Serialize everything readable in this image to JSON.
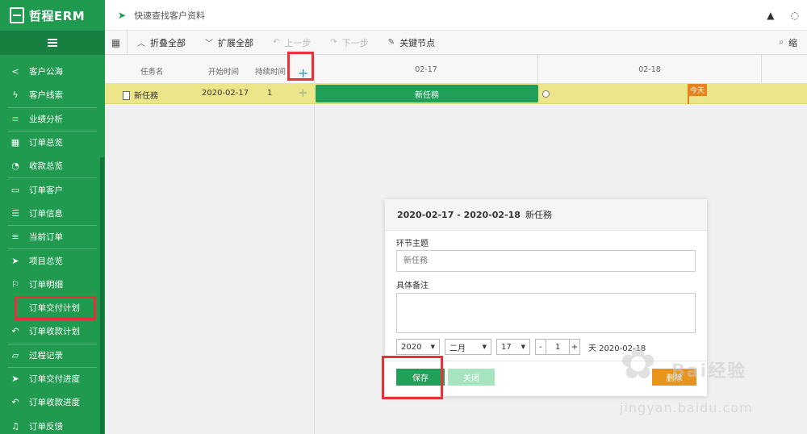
{
  "app": {
    "brand": "哲程ERM"
  },
  "sidebar": {
    "items": [
      {
        "label": "客户公海",
        "icon": "share-icon"
      },
      {
        "label": "客户线索",
        "icon": "bolt-icon"
      },
      {
        "label": "业绩分析",
        "icon": "bars-icon"
      },
      {
        "label": "订单总览",
        "icon": "grid-icon"
      },
      {
        "label": "收款总览",
        "icon": "rss-icon"
      },
      {
        "label": "订单客户",
        "icon": "laptop-icon"
      },
      {
        "label": "订单信息",
        "icon": "database-icon"
      },
      {
        "label": "当前订单",
        "icon": "list-icon"
      },
      {
        "label": "项目总览",
        "icon": "send-icon"
      },
      {
        "label": "订单明细",
        "icon": "flag-icon"
      },
      {
        "label": "订单交付计划",
        "icon": ""
      },
      {
        "label": "订单收款计划",
        "icon": "reply-icon"
      },
      {
        "label": "过程记录",
        "icon": "folder-icon"
      },
      {
        "label": "订单交付进度",
        "icon": "send-icon"
      },
      {
        "label": "订单收款进度",
        "icon": "reply-icon"
      },
      {
        "label": "订单反馈",
        "icon": "bell-icon"
      }
    ]
  },
  "topbar": {
    "search_text": "快速查找客户资料"
  },
  "toolbar": {
    "collapse_all": "折叠全部",
    "expand_all": "扩展全部",
    "undo": "上一步",
    "redo": "下一步",
    "critical_path": "关键节点",
    "zoom_label": "缩"
  },
  "grid": {
    "col_task": "任务名",
    "col_start": "开始时间",
    "col_duration": "持续时间",
    "add": "+"
  },
  "timeline": {
    "dates": [
      "02-17",
      "02-18"
    ]
  },
  "task": {
    "name": "新任務",
    "start": "2020-02-17",
    "duration": "1",
    "bar_label": "新任務",
    "today": "今天"
  },
  "dialog": {
    "range": "2020-02-17 - 2020-02-18",
    "task_name": "新任務",
    "subject_label": "环节主题",
    "subject_placeholder": "新任務",
    "notes_label": "具体备注",
    "year": "2020",
    "month": "二月",
    "day": "17",
    "minus": "-",
    "duration": "1",
    "plus": "+",
    "end_text": "天 2020-02-18",
    "save": "保存",
    "close": "关闭",
    "delete": "删除"
  },
  "watermark": {
    "logo": "Bai经验",
    "url": "jingyan.baidu.com"
  }
}
